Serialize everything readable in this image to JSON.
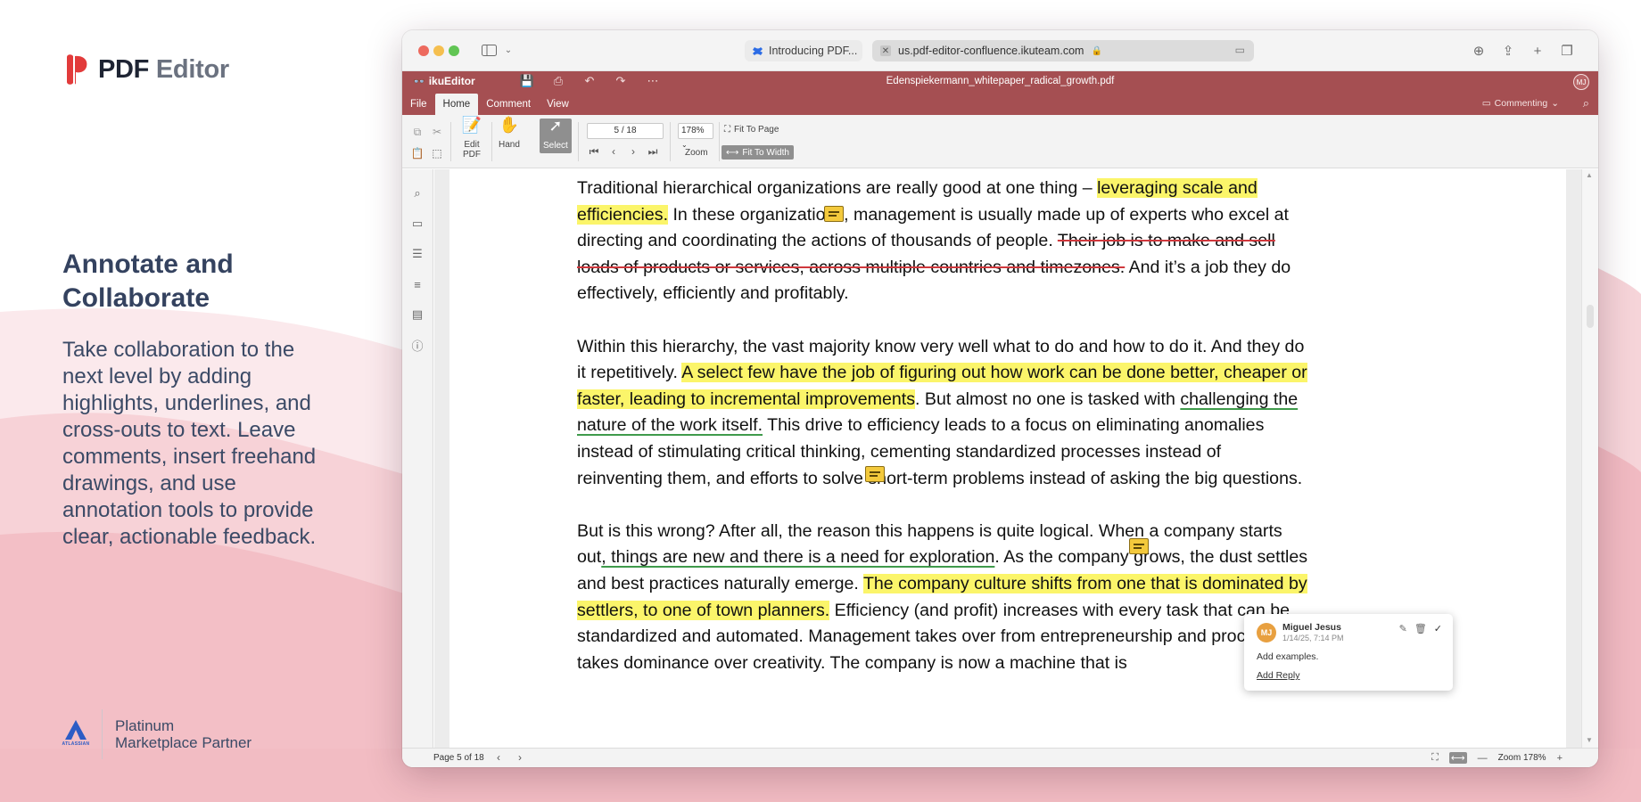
{
  "brand": {
    "name_strong": "PDF",
    "name_light": "Editor"
  },
  "marketing": {
    "headline": "Annotate and Collaborate",
    "body": "Take collaboration to the next level by adding highlights, underlines, and cross-outs to text. Leave comments, insert freehand drawings, and use annotation tools to provide clear, actionable feedback."
  },
  "partner": {
    "logo_text": "ATLASSIAN",
    "line1": "Platinum",
    "line2": "Marketplace Partner"
  },
  "browser": {
    "tab_inactive": "Introducing PDF...",
    "tab_active_url": "us.pdf-editor-confluence.ikuteam.com"
  },
  "app": {
    "logo": "ikuEditor",
    "doc_title": "Edenspiekermann_whitepaper_radical_growth.pdf",
    "user_initials": "MJ",
    "menu": [
      "File",
      "Home",
      "Comment",
      "View"
    ],
    "mode": "Commenting",
    "accent": "#a54f52"
  },
  "ribbon": {
    "edit_pdf": "Edit PDF",
    "hand": "Hand",
    "select": "Select",
    "page_value": "5 / 18",
    "zoom_value": "178%",
    "zoom_label": "Zoom",
    "fit_page": "Fit To Page",
    "fit_width": "Fit To Width"
  },
  "document": {
    "p1_a": "Traditional hierarchical organizations are really good at one thing – ",
    "p1_hl": "leveraging scale and efficiencies.",
    "p1_b": " In these organizations, management is usually made up of experts who excel at directing and coordinating the actions of thousands of people. ",
    "p1_strike": "Their job is to make and sell loads of products or services, across multiple countries and timezones.",
    "p1_c": " And it’s a job they do effectively, efficiently and profitably.",
    "p2_a": "Within this hierarchy, the vast majority know very well what to do and how to do it. And they do it repetitively. ",
    "p2_hl": "A select few have the job of figuring out how work can be done better, cheaper or faster, leading to incremental improvements",
    "p2_b": ". But almost no one is tasked with ",
    "p2_ul": "challenging the nature of the work itself.",
    "p2_c": " This drive to efficiency leads to a focus on eliminating anomalies instead of stimulating critical thinking, cementing standardized processes instead of reinventing them, and efforts to solve short-term problems instead of asking the big questions.",
    "p3_a": "But is this wrong? After all, the reason this happens is quite logical. When a company starts out",
    "p3_ul": ", things are new and there is a need for exploration",
    "p3_b": ". As the company grows, the dust settles and best practices naturally emerge. ",
    "p3_hl": "The company culture shifts from one that is dominated by settlers, to one of town planners.",
    "p3_c": " Efficiency (and profit) increases with every task that can be standardized and automated. Management takes over from entrepreneurship and process takes dominance over creativity. The company is now a machine that is"
  },
  "comment": {
    "initials": "MJ",
    "author": "Miguel Jesus",
    "date": "1/14/25, 7:14 PM",
    "text": "Add examples.",
    "reply": "Add Reply"
  },
  "status": {
    "page": "Page 5 of 18",
    "zoom": "Zoom 178%"
  }
}
